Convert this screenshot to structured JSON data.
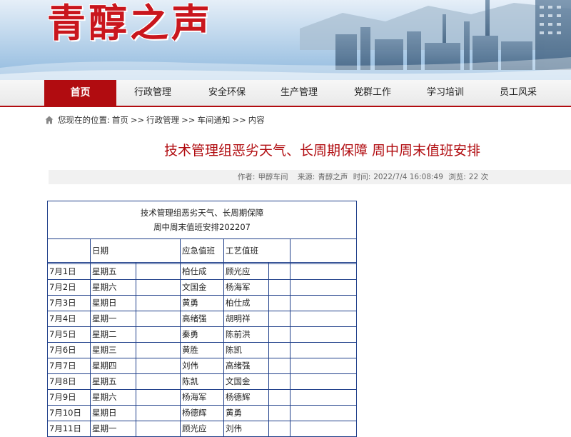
{
  "site": {
    "title": "青醇之声"
  },
  "nav": {
    "items": [
      {
        "label": "首页",
        "active": true
      },
      {
        "label": "行政管理"
      },
      {
        "label": "安全环保"
      },
      {
        "label": "生产管理"
      },
      {
        "label": "党群工作"
      },
      {
        "label": "学习培训"
      },
      {
        "label": "员工风采"
      }
    ]
  },
  "breadcrumb": {
    "prefix": "您现在的位置:",
    "items": [
      "首页",
      "行政管理",
      "车间通知",
      "内容"
    ],
    "sep": ">>"
  },
  "article": {
    "title": "技术管理组恶劣天气、长周期保障 周中周末值班安排",
    "meta": {
      "author_label": "作者:",
      "author": "甲醇车间",
      "source_label": "来源:",
      "source": "青醇之声",
      "time_label": "时间:",
      "time": "2022/7/4 16:08:49",
      "views_label": "浏览:",
      "views": "22 次"
    }
  },
  "table": {
    "caption_line1": "技术管理组恶劣天气、长周期保障",
    "caption_line2": "周中周末值班安排202207",
    "headers": [
      "",
      "日期",
      "",
      "应急值班",
      "工艺值班",
      "",
      ""
    ],
    "rows": [
      [
        "7月1日",
        "星期五",
        "柏仕成",
        "顾光应"
      ],
      [
        "7月2日",
        "星期六",
        "文国金",
        "杨海军"
      ],
      [
        "7月3日",
        "星期日",
        "黄勇",
        "柏仕成"
      ],
      [
        "7月4日",
        "星期一",
        "高绪强",
        "胡明祥"
      ],
      [
        "7月5日",
        "星期二",
        "秦勇",
        "陈前洪"
      ],
      [
        "7月6日",
        "星期三",
        "黄胜",
        "陈凯"
      ],
      [
        "7月7日",
        "星期四",
        "刘伟",
        "高绪强"
      ],
      [
        "7月8日",
        "星期五",
        "陈凯",
        "文国金"
      ],
      [
        "7月9日",
        "星期六",
        "杨海军",
        "杨德辉"
      ],
      [
        "7月10日",
        "星期日",
        "杨德辉",
        "黄勇"
      ],
      [
        "7月11日",
        "星期一",
        "顾光应",
        "刘伟"
      ]
    ]
  },
  "colors": {
    "brand_red": "#b10c10",
    "title_red": "#c9161d",
    "table_border": "#1f3f8a"
  }
}
